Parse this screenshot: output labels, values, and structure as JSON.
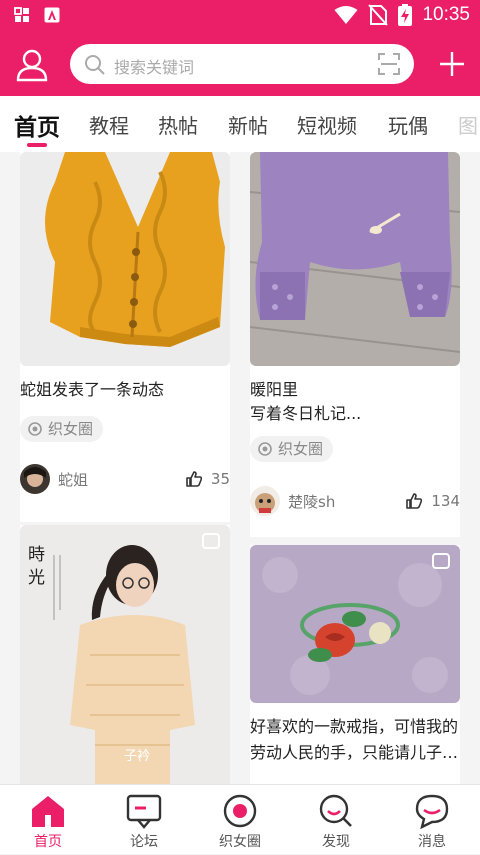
{
  "status": {
    "time": "10:35"
  },
  "search": {
    "placeholder": "搜索关键词"
  },
  "tabs": [
    "首页",
    "教程",
    "热帖",
    "新帖",
    "短视频",
    "玩偶",
    "图"
  ],
  "cards": [
    {
      "title": "蛇姐发表了一条动态",
      "tag": "织女圈",
      "author": "蛇姐",
      "likes": "35"
    },
    {
      "title_line1": "暖阳里",
      "title_line2": "写着冬日札记...",
      "tag": "织女圈",
      "author": "楚陵sh",
      "likes": "134"
    },
    {
      "image_text_1": "時",
      "image_text_2": "光",
      "image_caption": "子衿"
    },
    {
      "title_line1": "好喜欢的一款戒指，可惜我的",
      "title_line2": "劳动人民的手，只能请儿子…"
    }
  ],
  "nav": [
    {
      "label": "首页",
      "icon": "home-icon"
    },
    {
      "label": "论坛",
      "icon": "forum-icon"
    },
    {
      "label": "织女圈",
      "icon": "circle-icon"
    },
    {
      "label": "发现",
      "icon": "discover-icon"
    },
    {
      "label": "消息",
      "icon": "message-icon"
    }
  ],
  "colors": {
    "accent": "#ea1f67"
  }
}
